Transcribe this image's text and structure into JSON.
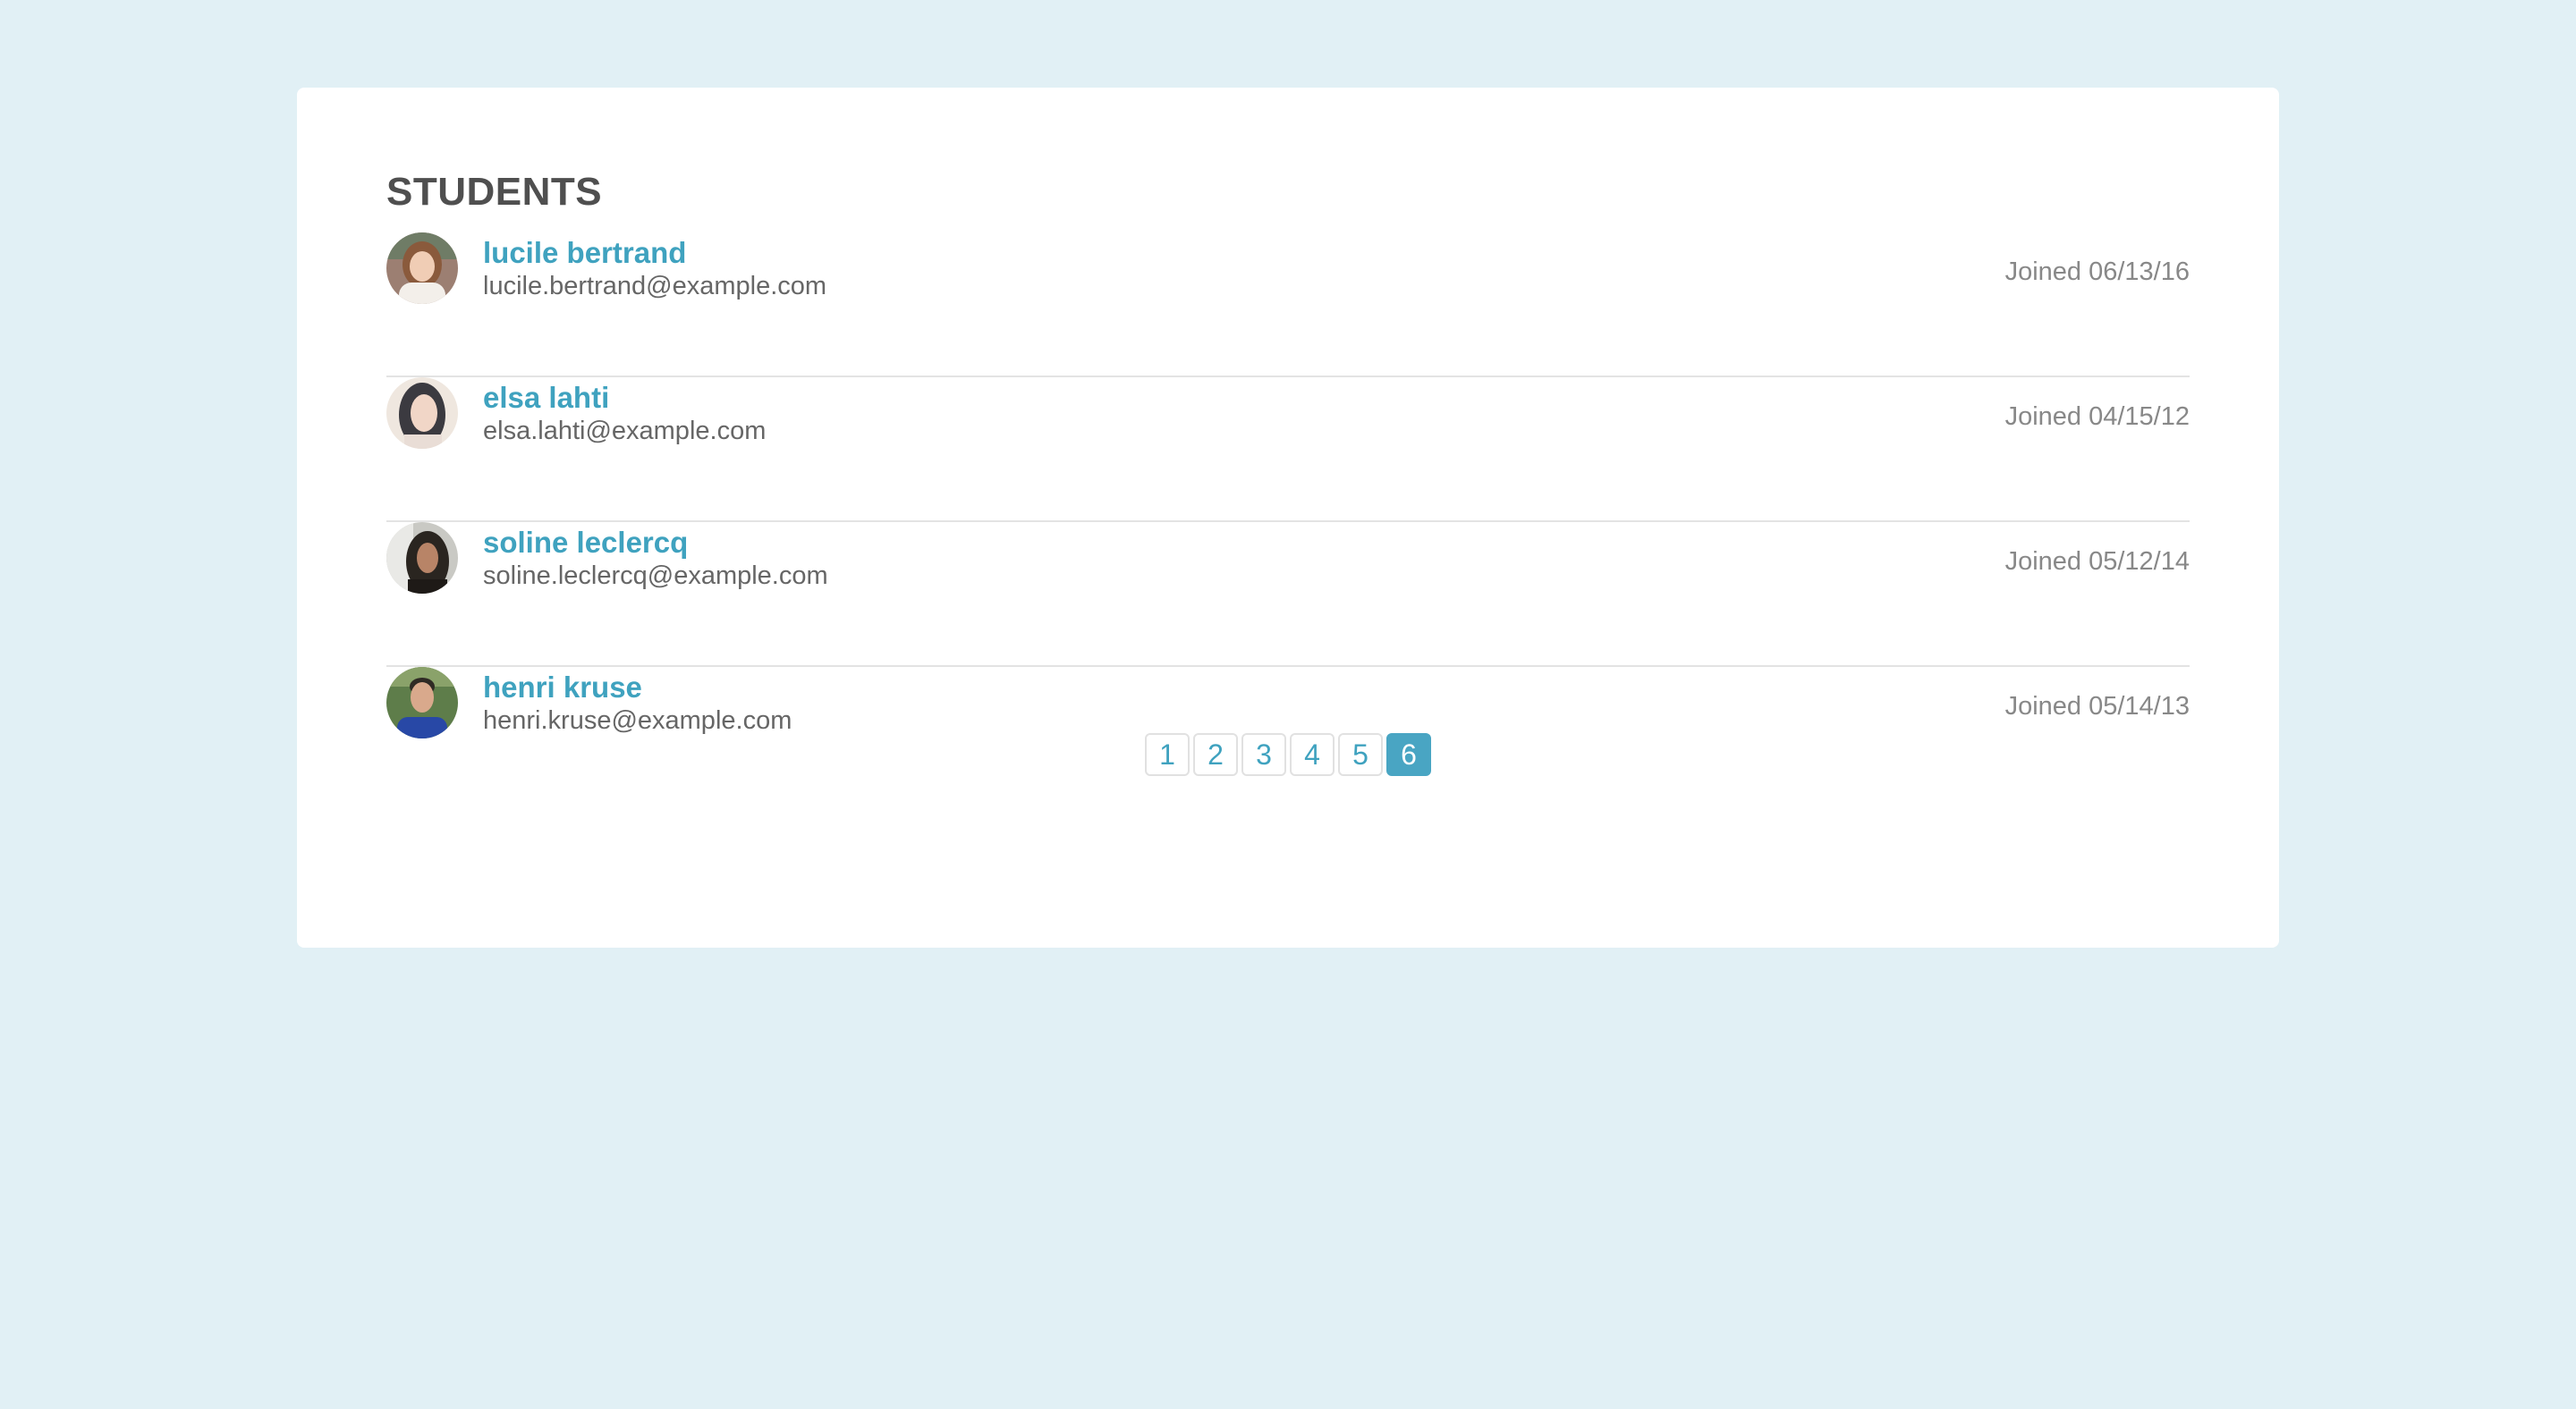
{
  "header": {
    "title": "STUDENTS"
  },
  "students": [
    {
      "name": "lucile bertrand",
      "email": "lucile.bertrand@example.com",
      "joined": "Joined 06/13/16",
      "avatar": "avatar-photo"
    },
    {
      "name": "elsa lahti",
      "email": "elsa.lahti@example.com",
      "joined": "Joined 04/15/12",
      "avatar": "avatar-photo"
    },
    {
      "name": "soline leclercq",
      "email": "soline.leclercq@example.com",
      "joined": "Joined 05/12/14",
      "avatar": "avatar-photo"
    },
    {
      "name": "henri kruse",
      "email": "henri.kruse@example.com",
      "joined": "Joined 05/14/13",
      "avatar": "avatar-photo"
    }
  ],
  "pagination": {
    "pages": [
      "1",
      "2",
      "3",
      "4",
      "5",
      "6"
    ],
    "current": "6"
  },
  "colors": {
    "background": "#e1f0f5",
    "card": "#ffffff",
    "accent": "#49a5c3",
    "link": "#3fa2bf",
    "title": "#4f4f4f"
  }
}
